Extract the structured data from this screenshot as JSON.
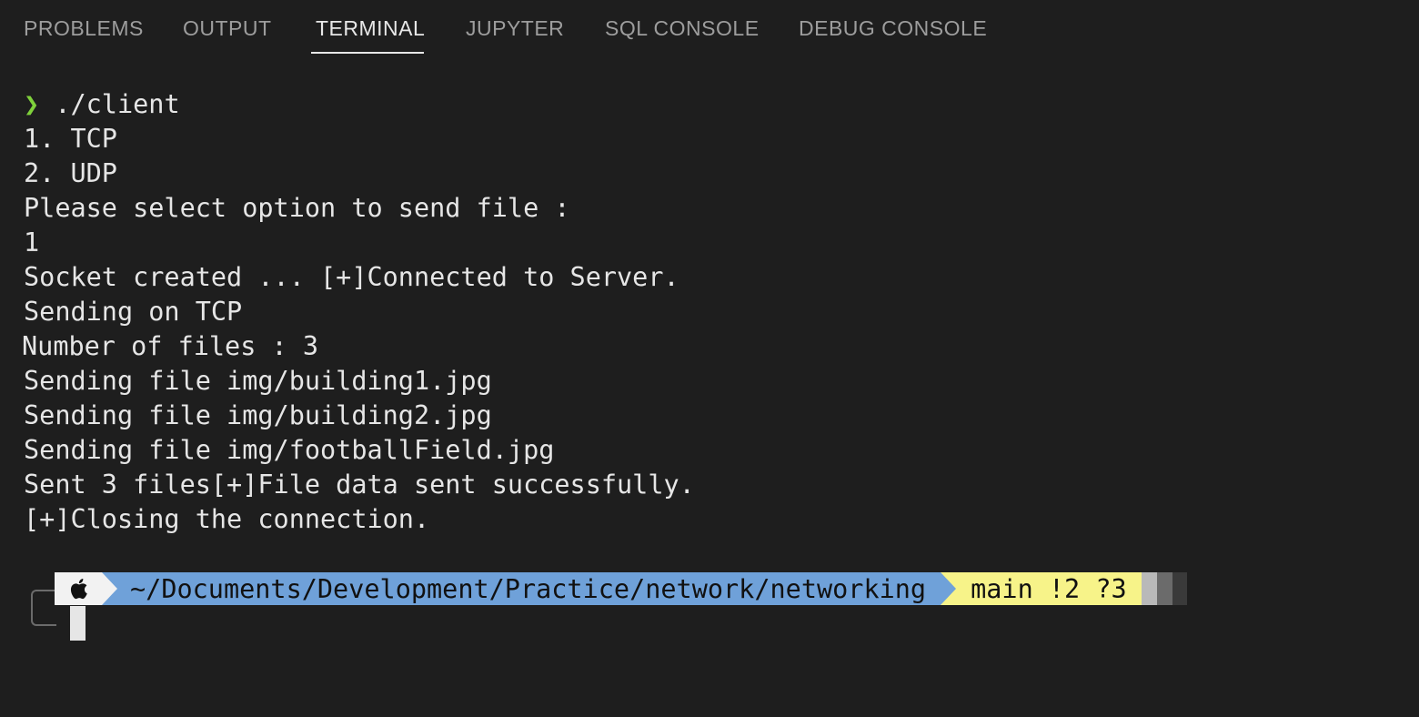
{
  "tabs": [
    {
      "label": "PROBLEMS"
    },
    {
      "label": "OUTPUT"
    },
    {
      "label": "TERMINAL"
    },
    {
      "label": "JUPYTER"
    },
    {
      "label": "SQL CONSOLE"
    },
    {
      "label": "DEBUG CONSOLE"
    }
  ],
  "active_tab": "TERMINAL",
  "terminal": {
    "prompt_symbol": "❯",
    "command": " ./client",
    "lines": [
      "1. TCP",
      "2. UDP",
      "Please select option to send file :",
      "1",
      "Socket created ... [+]Connected to Server.",
      "Sending on TCP",
      "Number of files : 3",
      "Sending file img/building1.jpg",
      "Sending file img/building2.jpg",
      "Sending file img/footballField.jpg",
      "Sent 3 files[+]File data sent successfully.",
      "[+]Closing the connection."
    ]
  },
  "prompt": {
    "os_icon": "apple-icon",
    "path": "~/Documents/Development/Practice/network/networking",
    "git": "main !2 ?3"
  },
  "colors": {
    "background": "#1e1e1e",
    "caret": "#7fd13b",
    "path_segment": "#6fa1d9",
    "git_segment": "#f7f389"
  }
}
